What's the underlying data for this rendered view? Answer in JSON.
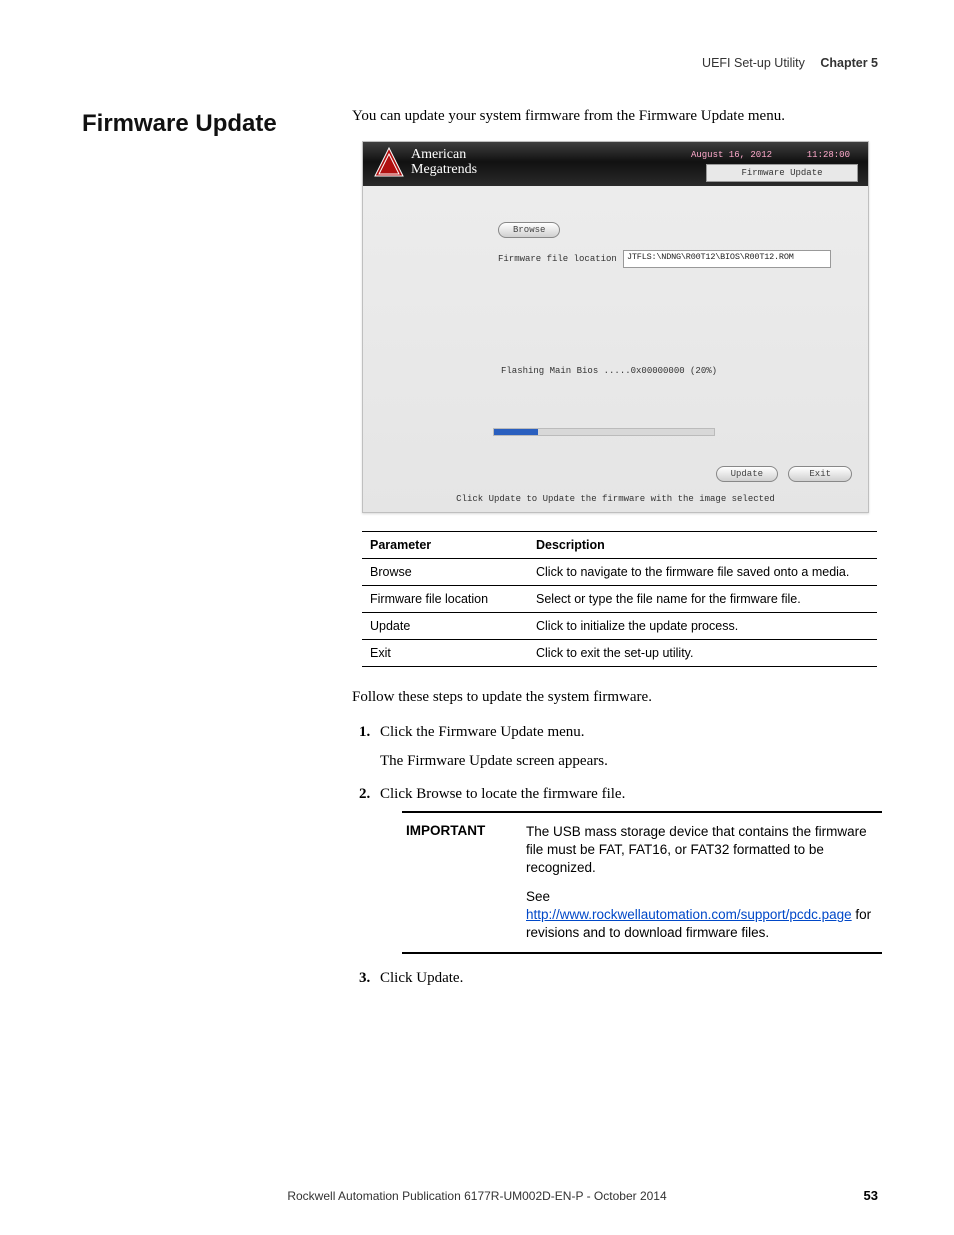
{
  "header": {
    "section": "UEFI Set-up Utility",
    "chapter": "Chapter 5"
  },
  "heading": "Firmware Update",
  "intro": "You can update your system firmware from the Firmware Update menu.",
  "screenshot": {
    "brand1": "American",
    "brand2": "Megatrends",
    "date": "August 16, 2012",
    "time": "11:28:00",
    "title": "Firmware Update",
    "browse": "Browse",
    "file_label": "Firmware file location",
    "file_value": "JTFLS:\\NDNG\\R00T12\\BIOS\\R00T12.ROM",
    "flashing": "Flashing Main Bios .....0x00000000 (20%)",
    "update": "Update",
    "exit": "Exit",
    "hint": "Click Update to Update the firmware with the image selected"
  },
  "param_table": {
    "h1": "Parameter",
    "h2": "Description",
    "rows": [
      {
        "p": "Browse",
        "d": "Click to navigate to the firmware file saved onto a media."
      },
      {
        "p": "Firmware file location",
        "d": "Select or type the file name for the firmware file."
      },
      {
        "p": "Update",
        "d": "Click to initialize the update process."
      },
      {
        "p": "Exit",
        "d": "Click to exit the set-up utility."
      }
    ]
  },
  "follow": "Follow these steps to update the system firmware.",
  "steps": {
    "s1": "Click the Firmware Update menu.",
    "s1_sub": "The Firmware Update screen appears.",
    "s2": "Click Browse to locate the firmware file.",
    "s3": "Click Update."
  },
  "important": {
    "label": "IMPORTANT",
    "p1": "The USB mass storage device that contains the firmware file must be FAT, FAT16, or FAT32 formatted to be recognized.",
    "p2_pre": "See ",
    "link": "http://www.rockwellautomation.com/support/pcdc.page",
    "p2_post": " for revisions and to download firmware files."
  },
  "footer": "Rockwell Automation Publication 6177R-UM002D-EN-P - October 2014",
  "page_num": "53"
}
